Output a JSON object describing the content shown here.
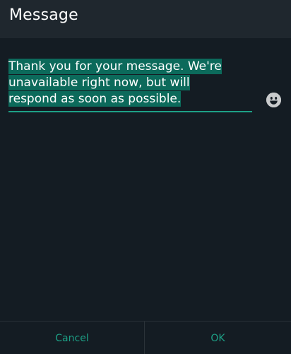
{
  "dialog": {
    "title": "Message",
    "message_lines": [
      "Thank you for your message. We're",
      "unavailable right now, but will",
      "respond as soon as possible."
    ],
    "emoji_icon": "smiley-face-icon",
    "buttons": {
      "cancel": "Cancel",
      "ok": "OK"
    }
  },
  "colors": {
    "background": "#141c23",
    "header": "#1f272e",
    "accent": "#1da086",
    "selection": "#0c6a5b"
  }
}
